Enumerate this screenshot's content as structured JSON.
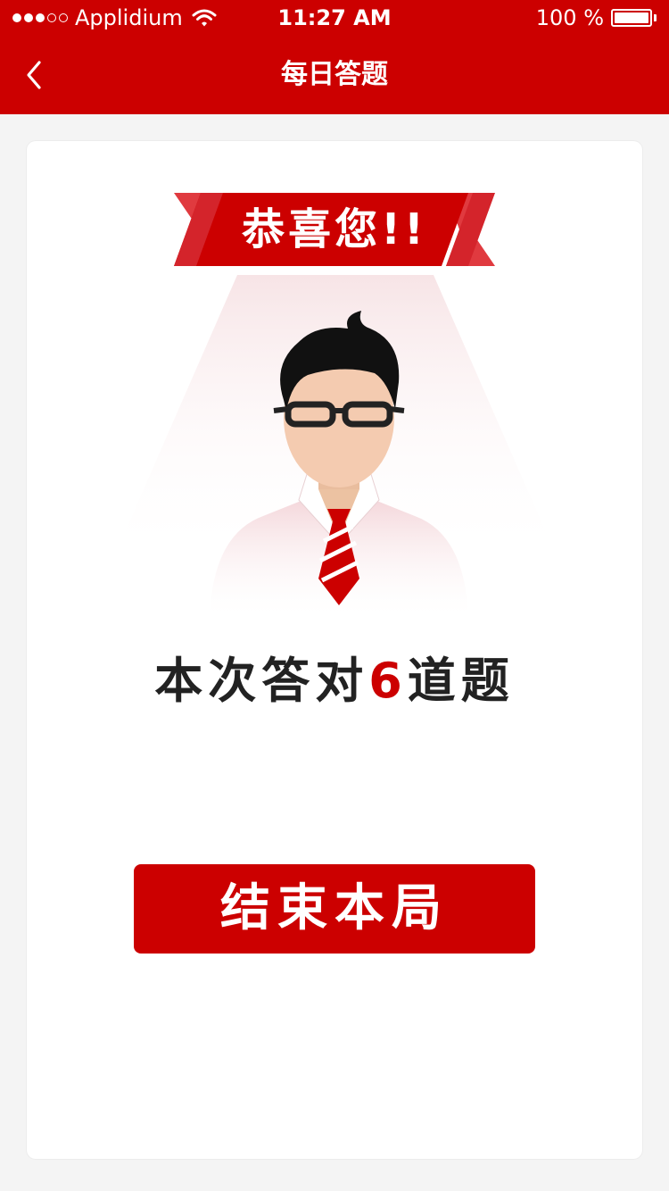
{
  "status_bar": {
    "carrier": "Applidium",
    "time": "11:27 AM",
    "battery": "100 %",
    "signal_icon": "signal-dots-icon",
    "wifi_icon": "wifi-icon",
    "battery_icon": "battery-icon"
  },
  "nav": {
    "title": "每日答题",
    "back_icon": "chevron-left-icon"
  },
  "banner": {
    "text": "恭喜您!!"
  },
  "result": {
    "prefix": "本次答对",
    "count": "6",
    "suffix": "道题"
  },
  "actions": {
    "end_label": "结束本局"
  },
  "colors": {
    "primary": "#cc0000",
    "background": "#f4f4f4",
    "card": "#ffffff",
    "text": "#222222"
  }
}
